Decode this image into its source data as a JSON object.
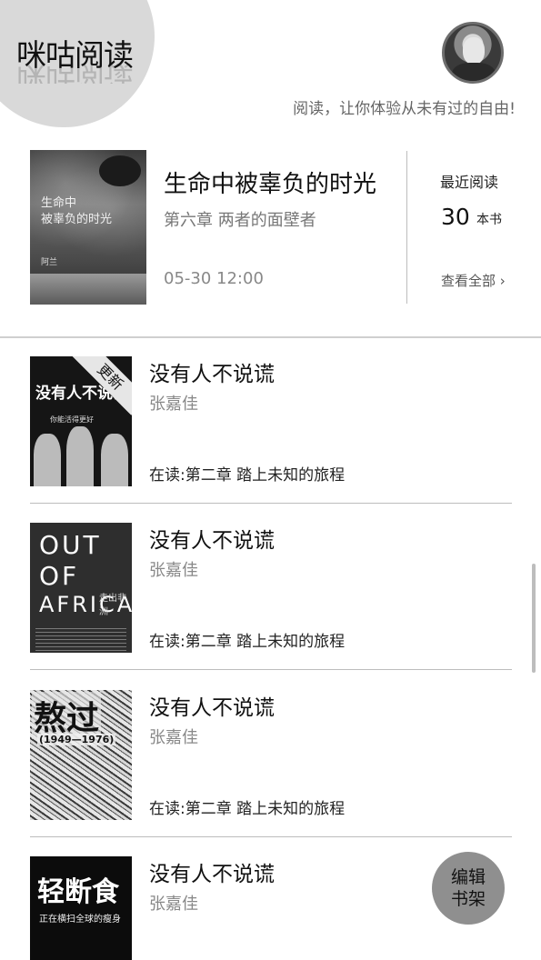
{
  "header": {
    "logo": "咪咕阅读",
    "slogan": "阅读，让你体验从未有过的自由!"
  },
  "featured": {
    "cover_title": "生命中\n被辜负的时光",
    "cover_author": "阿兰",
    "title": "生命中被辜负的时光",
    "chapter": "第六章  两者的面壁者",
    "time": "05-30 12:00",
    "recent_label": "最近阅读",
    "recent_count": "30",
    "recent_unit": "本书",
    "view_all": "查看全部 ›"
  },
  "books": [
    {
      "title": "没有人不说谎",
      "author": "张嘉佳",
      "progress": "在读:第二章 踏上未知的旅程",
      "badge": "更新",
      "cover_text": "没有人不说谎",
      "cover_sub": "你能活得更好"
    },
    {
      "title": "没有人不说谎",
      "author": "张嘉佳",
      "progress": "在读:第二章 踏上未知的旅程",
      "cover_lines": [
        "OUT",
        "OF",
        "AFRICA"
      ],
      "cover_cn": "走出非洲"
    },
    {
      "title": "没有人不说谎",
      "author": "张嘉佳",
      "progress": "在读:第二章 踏上未知的旅程",
      "cover_text": "熬过",
      "cover_years": "(1949—1976)"
    },
    {
      "title": "没有人不说谎",
      "author": "张嘉佳",
      "cover_text": "轻断食",
      "cover_sub": "正在横扫全球的瘦身"
    }
  ],
  "edit_button": {
    "line1": "编辑",
    "line2": "书架"
  }
}
